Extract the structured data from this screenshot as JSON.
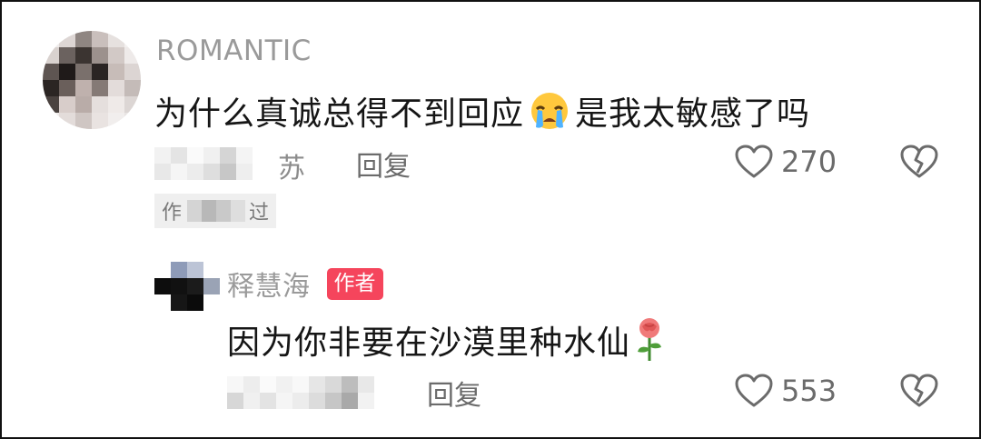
{
  "comments": [
    {
      "username": "ROMANTIC",
      "text": "为什么真诚总得不到回应",
      "emoji": "loudly-crying-face",
      "text_after_emoji": "是我太敏感了吗",
      "meta_visible": "苏",
      "reply_label": "回复",
      "likes": "270",
      "liked_by_author_visible_left": "作",
      "liked_by_author_visible_right": "过"
    },
    {
      "username": "释慧海",
      "badge": "作者",
      "text": "因为你非要在沙漠里种水仙",
      "emoji": "rose",
      "reply_label": "回复",
      "likes": "553"
    }
  ],
  "icons": {
    "like": "heart-outline-icon",
    "dislike": "broken-heart-icon"
  }
}
